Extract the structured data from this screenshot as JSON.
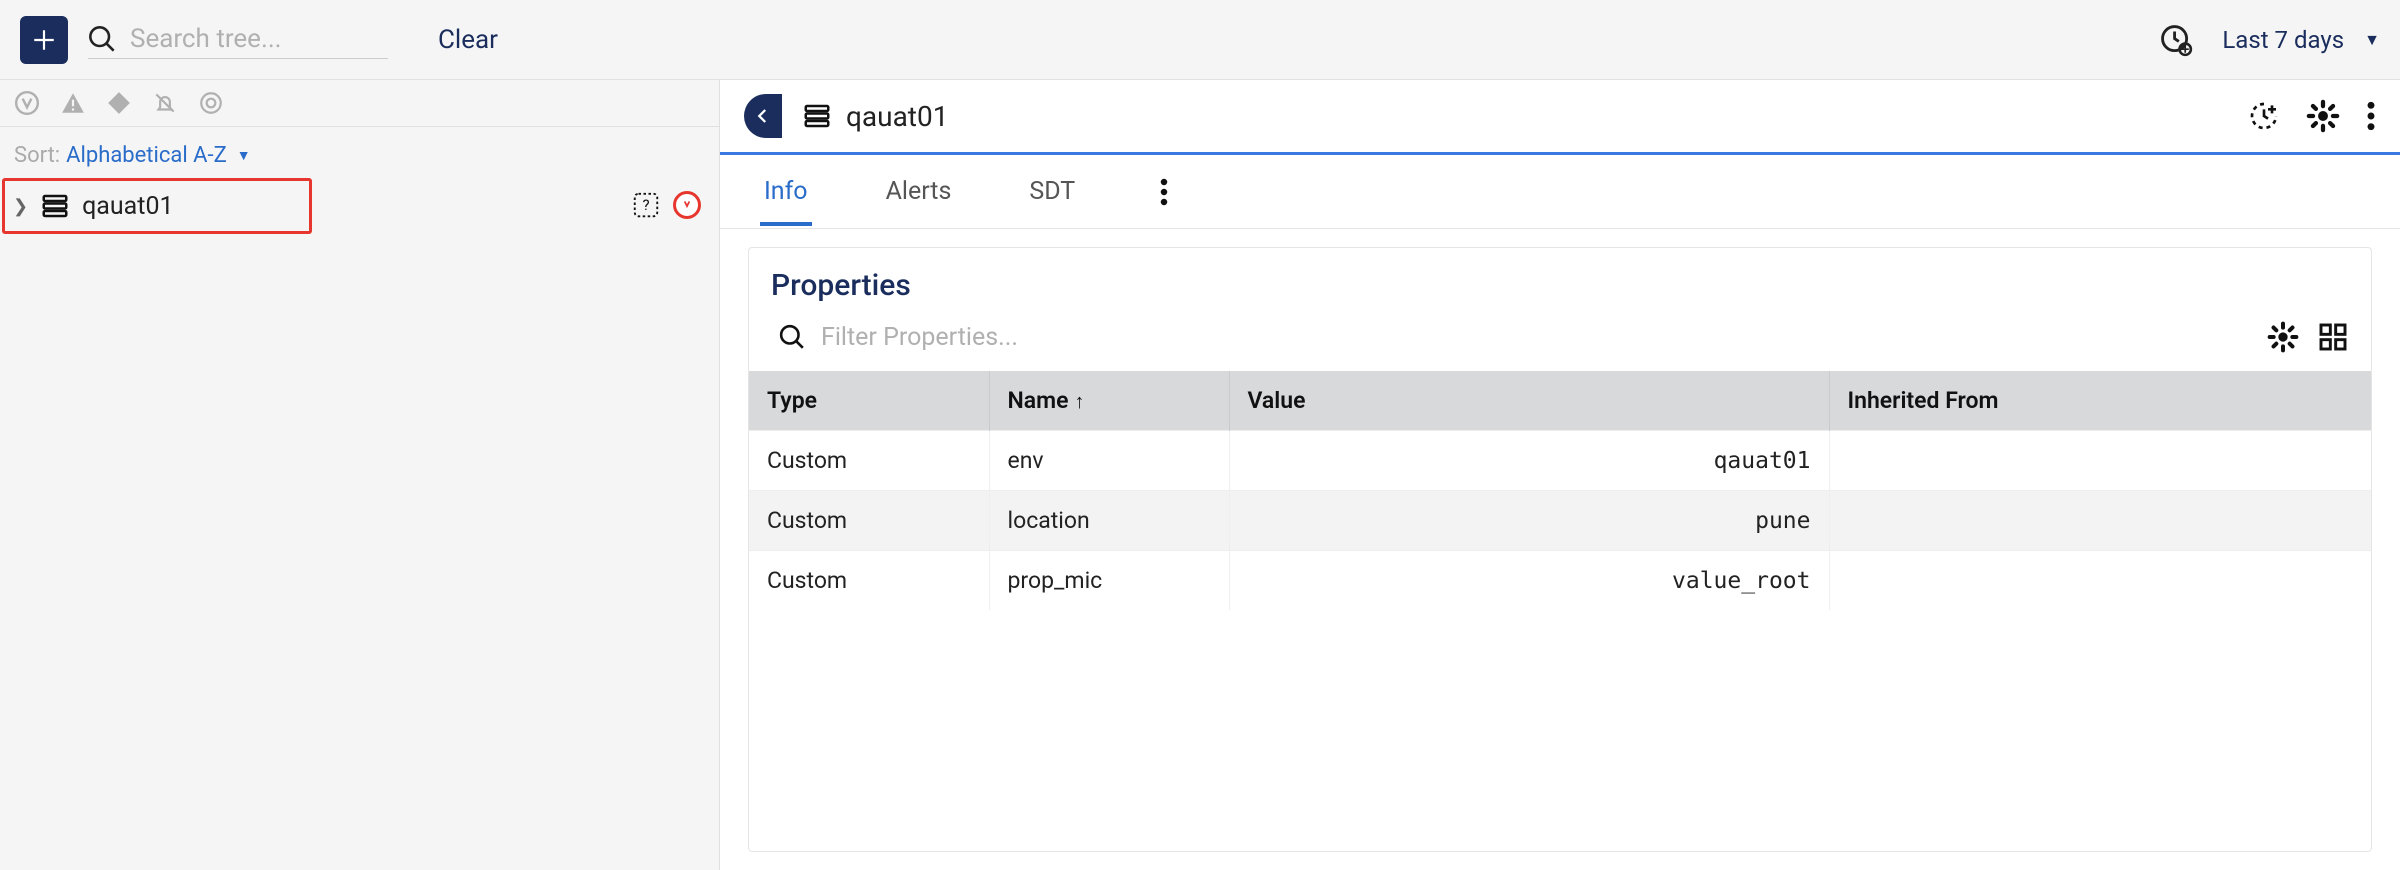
{
  "toolbar": {
    "search_placeholder": "Search tree...",
    "clear_label": "Clear",
    "range_label": "Last 7 days"
  },
  "sidebar": {
    "sort_label": "Sort:",
    "sort_value": "Alphabetical A-Z",
    "tree": {
      "root_label": "qauat01"
    }
  },
  "detail": {
    "title": "qauat01",
    "tabs": {
      "info": "Info",
      "alerts": "Alerts",
      "sdt": "SDT"
    },
    "properties": {
      "heading": "Properties",
      "filter_placeholder": "Filter Properties...",
      "columns": {
        "type": "Type",
        "name": "Name",
        "value": "Value",
        "inherited": "Inherited From"
      },
      "rows": [
        {
          "type": "Custom",
          "name": "env",
          "value": "qauat01",
          "inherited": ""
        },
        {
          "type": "Custom",
          "name": "location",
          "value": "pune",
          "inherited": ""
        },
        {
          "type": "Custom",
          "name": "prop_mic",
          "value": "value_root",
          "inherited": ""
        }
      ]
    }
  }
}
